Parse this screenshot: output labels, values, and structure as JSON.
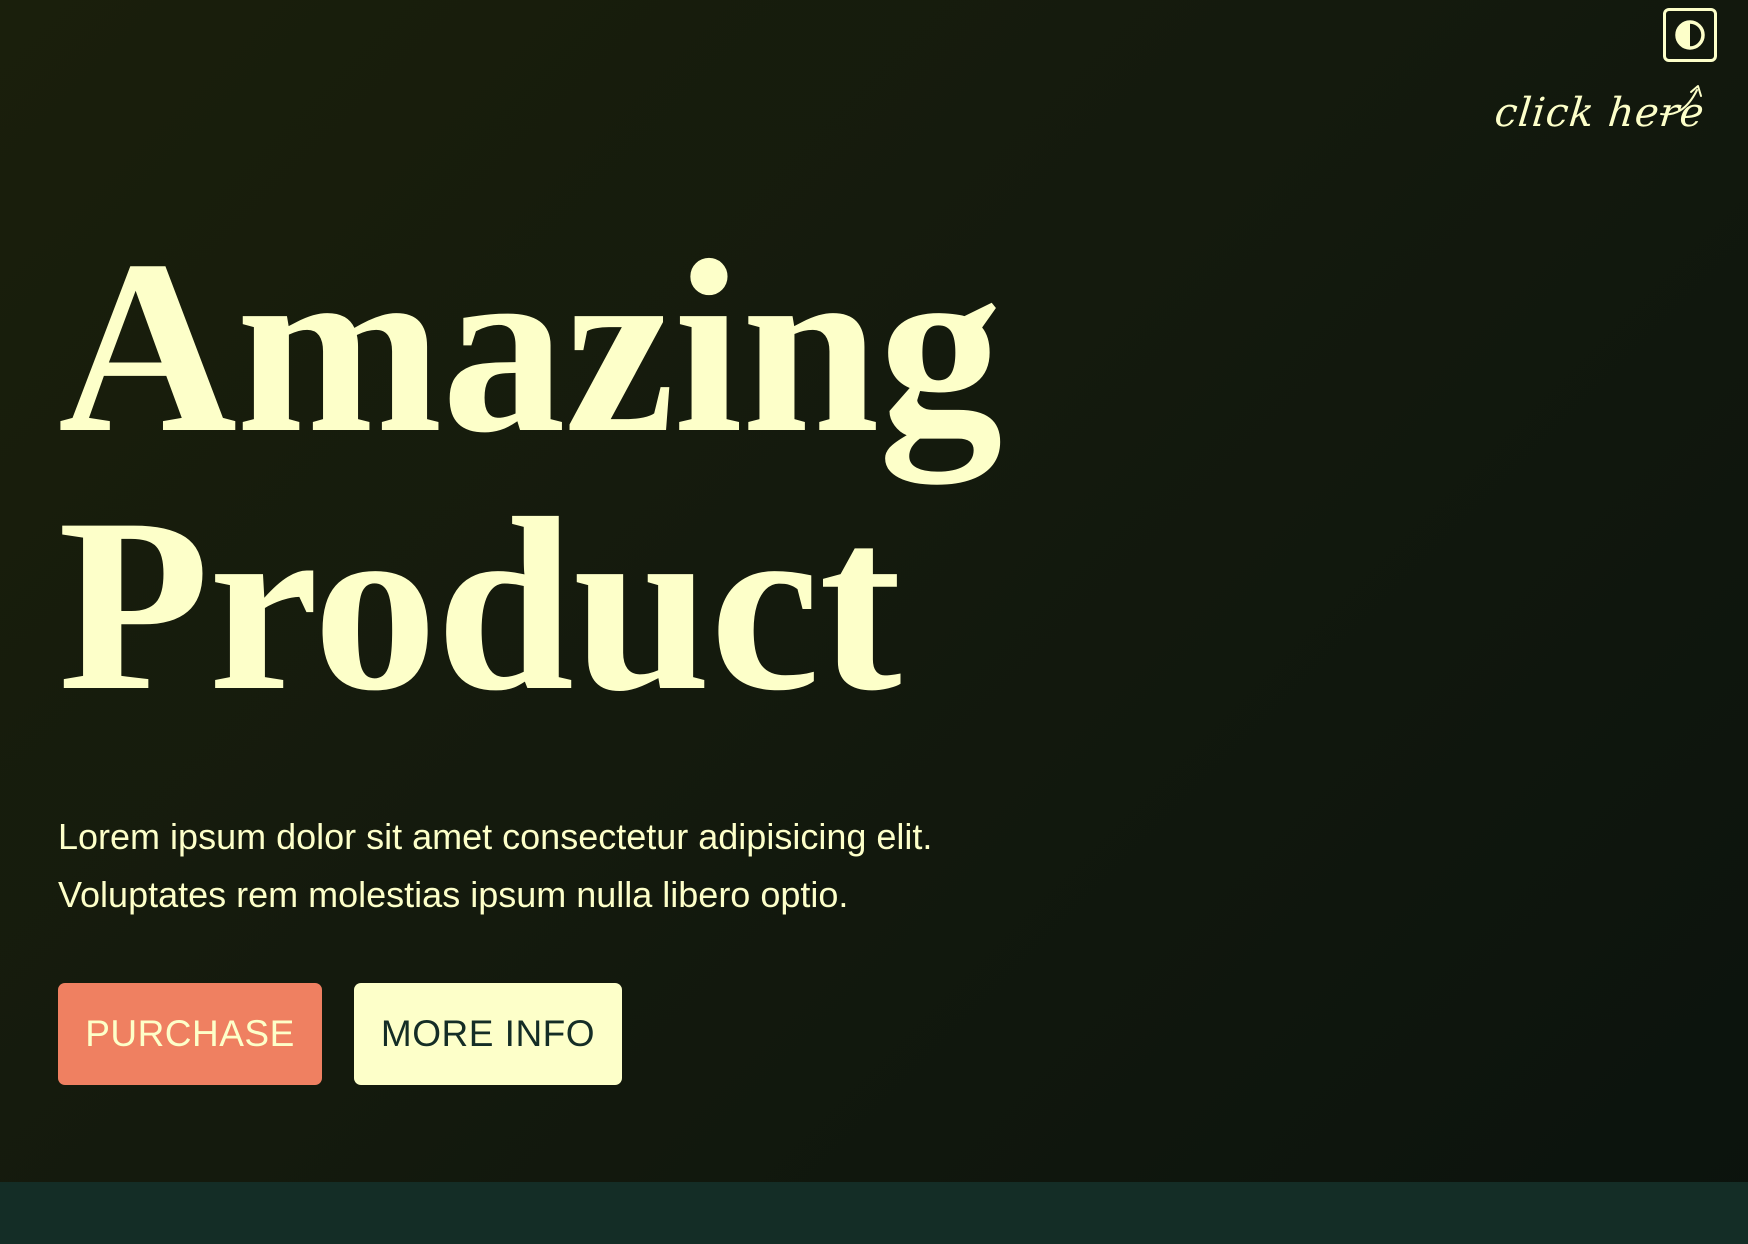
{
  "hero": {
    "headline_line1": "Amazing",
    "headline_line2": "Product",
    "lede_line1": "Lorem ipsum dolor sit amet consectetur adipisicing elit.",
    "lede_line2": "Voluptates rem molestias ipsum nulla libero optio.",
    "purchase_label": "PURCHASE",
    "more_info_label": "MORE INFO"
  },
  "theme_toggle": {
    "icon": "contrast-icon",
    "hint": "click here"
  },
  "colors": {
    "background": "#151b0d",
    "text": "#fdffc9",
    "accent": "#ef8061",
    "footer": "#142d26"
  }
}
